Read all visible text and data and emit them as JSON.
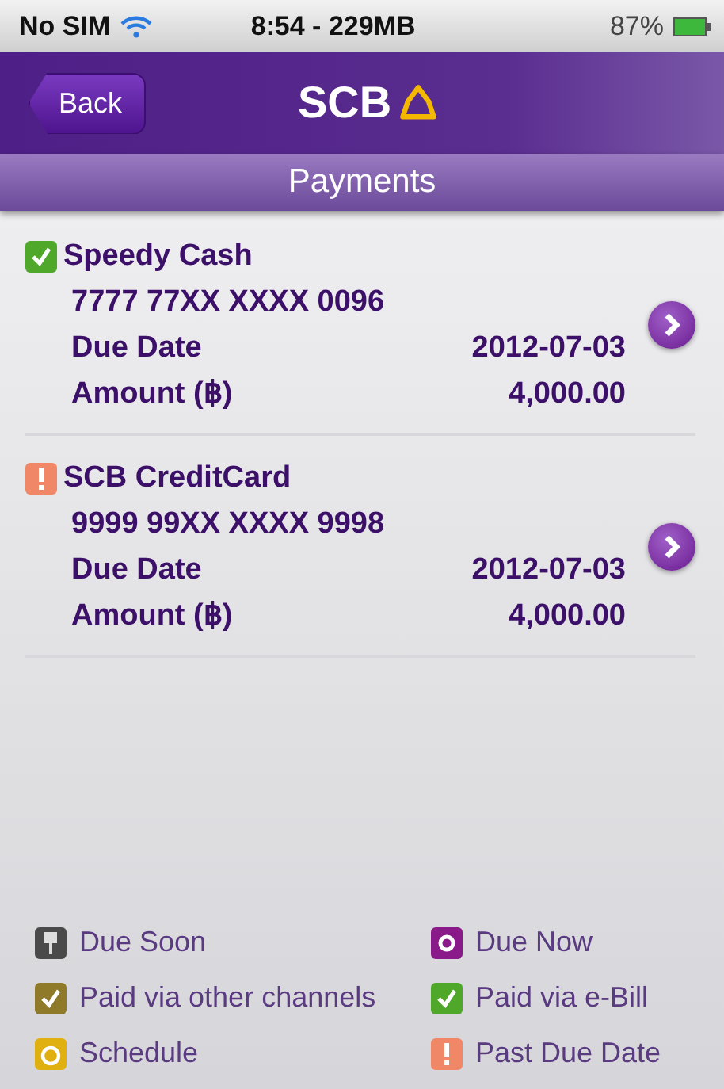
{
  "status_bar": {
    "carrier": "No SIM",
    "time": "8:54 - 229MB",
    "battery": "87%"
  },
  "header": {
    "back": "Back",
    "logo": "SCB"
  },
  "title": "Payments",
  "payments": [
    {
      "kind": "paid_ebill",
      "name": "Speedy Cash",
      "number": "7777 77XX XXXX 0096",
      "due_label": "Due Date",
      "due_date": "2012-07-03",
      "amount_label": "Amount (฿)",
      "amount": "4,000.00"
    },
    {
      "kind": "past_due",
      "name": "SCB CreditCard",
      "number": "9999 99XX XXXX 9998",
      "due_label": "Due Date",
      "due_date": "2012-07-03",
      "amount_label": "Amount (฿)",
      "amount": "4,000.00"
    }
  ],
  "legend": [
    {
      "kind": "due_soon",
      "label": "Due Soon"
    },
    {
      "kind": "due_now",
      "label": "Due Now"
    },
    {
      "kind": "paid_other",
      "label": "Paid via other channels"
    },
    {
      "kind": "paid_ebill",
      "label": "Paid via e-Bill"
    },
    {
      "kind": "schedule",
      "label": "Schedule"
    },
    {
      "kind": "past_due",
      "label": "Past Due Date"
    }
  ]
}
